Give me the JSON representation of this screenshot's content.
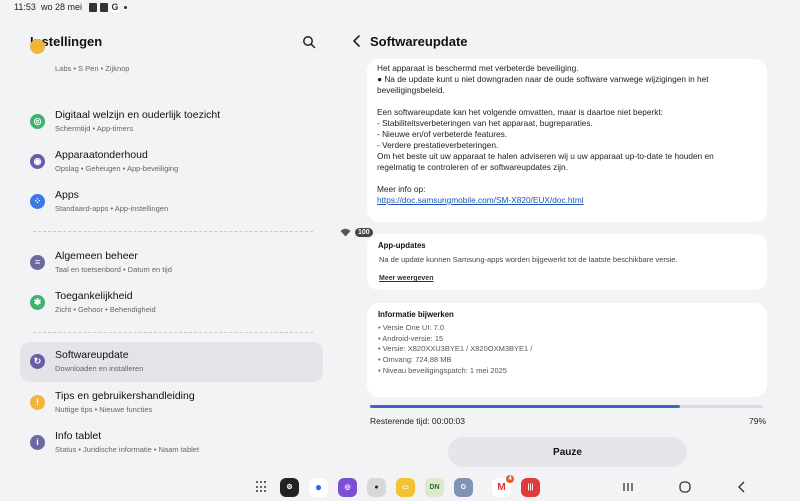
{
  "status_bar": {
    "time": "11:53",
    "date": "wo 28 mei",
    "battery": "100"
  },
  "left_pane": {
    "title": "Instellingen",
    "partial_item_sub": "Labs  •  S Pen  •  Zijknop",
    "items": [
      {
        "title": "Digitaal welzijn en ouderlijk toezicht",
        "sub": "Schermtijd  •  App-timers",
        "icon_color": "#3db36b"
      },
      {
        "title": "Apparaatonderhoud",
        "sub": "Opslag  •  Geheugen  •  App-beveiliging",
        "icon_color": "#6b5ca8"
      },
      {
        "title": "Apps",
        "sub": "Standaard-apps  •  App-instellingen",
        "icon_color": "#3b78e7"
      },
      {
        "title": "Algemeen beheer",
        "sub": "Taal en toetsenbord  •  Datum en tijd",
        "icon_color": "#6a6aa0"
      },
      {
        "title": "Toegankelijkheid",
        "sub": "Zicht  •  Gehoor  •  Behendigheid",
        "icon_color": "#3db36b"
      },
      {
        "title": "Softwareupdate",
        "sub": "Downloaden en installeren",
        "icon_color": "#6b5ca8"
      },
      {
        "title": "Tips en gebruikershandleiding",
        "sub": "Nuttige tips  •  Nieuwe functies",
        "icon_color": "#f0b43a"
      },
      {
        "title": "Info tablet",
        "sub": "Status  •  Juridische informatie  •  Naam tablet",
        "icon_color": "#6a6aa0"
      }
    ]
  },
  "right_pane": {
    "title": "Softwareupdate",
    "notes": {
      "line1": "Het apparaat is beschermd met verbeterde beveiliging.",
      "line2": "● Na de update kunt u niet downgraden naar de oude software vanwege wijzigingen in het",
      "line3": "beveiligingsbeleid.",
      "line4": "Een softwareupdate kan het volgende omvatten, maar is daartoe niet beperkt:",
      "line5": " - Stabiliteitsverbeteringen van het apparaat, bugreparaties.",
      "line6": " - Nieuwe en/of verbeterde features.",
      "line7": " - Verdere prestatieverbeteringen.",
      "line8": "Om het beste uit uw apparaat te halen adviseren wij u uw apparaat up-to-date te houden en",
      "line9": "regelmatig te controleren of er softwareupdates zijn.",
      "more_info": "Meer info op:",
      "link": "https://doc.samsungmobile.com/SM-X820/EUX/doc.html"
    },
    "app_updates": {
      "heading": "App-updates",
      "desc": "Na de update kunnen Samsung-apps worden bijgewerkt tot de laatste beschikbare versie.",
      "more": "Meer weergeven"
    },
    "update_info": {
      "heading": "Informatie bijwerken",
      "lines": [
        "• Versie One UI: 7.0",
        "• Android-versie: 15",
        "• Versie: X820XXU3BYE1 / X820OXM3BYE1 /",
        "• Omvang: 724,88 MB",
        "• Niveau beveiligingspatch: 1 mei 2025"
      ]
    },
    "progress_percent": 79,
    "remaining": "Resterende tijd: 00:00:03",
    "percent_label": "79%",
    "pause_label": "Pauze"
  },
  "taskbar": {
    "apps": [
      {
        "name": "settings",
        "color": "#222222",
        "label": "⚙"
      },
      {
        "name": "messages",
        "color": "#2a6fe0",
        "label": "💬"
      },
      {
        "name": "internet",
        "color": "#7a4fd6",
        "label": "◎"
      },
      {
        "name": "camera",
        "color": "#d8d8d8",
        "label": "●"
      },
      {
        "name": "notes",
        "color": "#f2c230",
        "label": "▭"
      },
      {
        "name": "dn",
        "color": "#dfe8c6",
        "label": "DN"
      },
      {
        "name": "translate",
        "color": "#7d93b8",
        "label": "G"
      },
      {
        "name": "gmail",
        "color": "#ffffff",
        "label": "M"
      },
      {
        "name": "voice",
        "color": "#e03a3a",
        "label": "|||"
      }
    ],
    "gmail_badge": "4"
  }
}
